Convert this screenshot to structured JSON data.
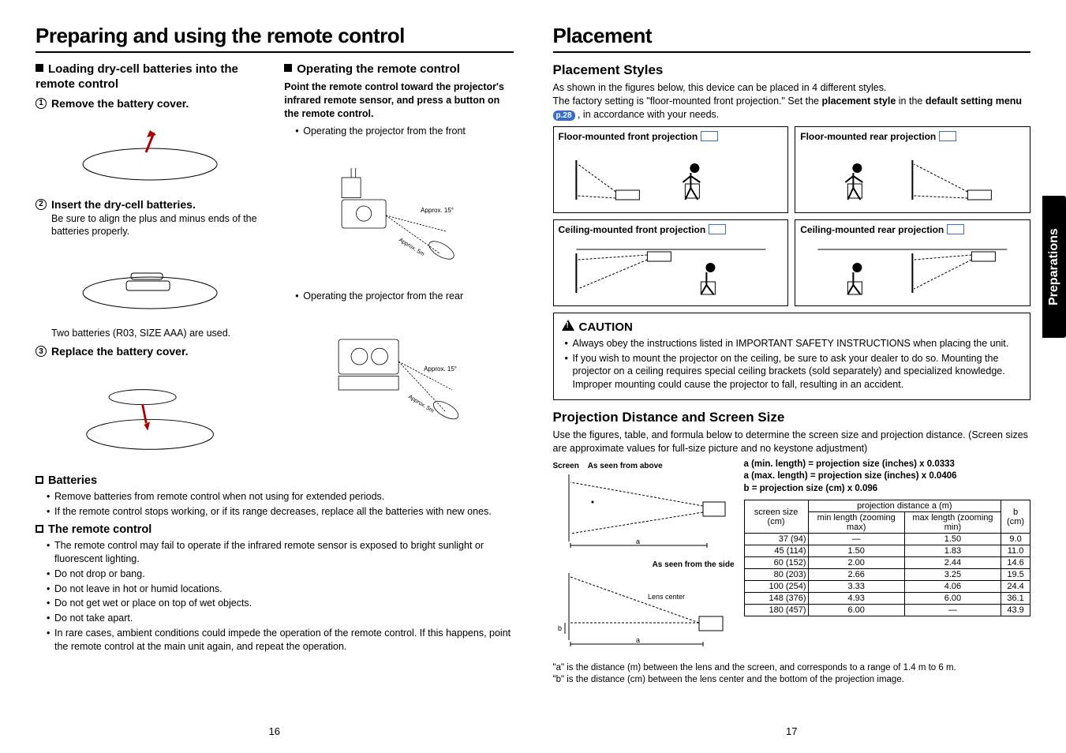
{
  "left": {
    "title": "Preparing and using the remote control",
    "loading_heading": "Loading dry-cell batteries into the remote control",
    "step1": "Remove the battery cover.",
    "step2": "Insert the dry-cell batteries.",
    "step2_note": "Be sure to align the plus and minus ends of the batteries properly.",
    "step2_note2": "Two batteries (R03, SIZE AAA) are used.",
    "step3": "Replace the battery cover.",
    "operating_heading": "Operating the remote control",
    "operating_intro": "Point the remote control toward the projector's infrared remote sensor, and press a button on the remote control.",
    "op_front": "Operating the projector from the front",
    "op_rear": "Operating the projector from the rear",
    "approx_angle": "Approx. 15°",
    "approx_dist": "Approx. 5m",
    "batteries_heading": "Batteries",
    "batteries_bullets": [
      "Remove batteries from remote control when not using for extended periods.",
      "If the remote control stops working, or if its range decreases, replace all the batteries with new ones."
    ],
    "remote_heading": "The remote control",
    "remote_bullets": [
      "The remote control may fail to operate if the infrared remote sensor is exposed to bright sunlight or fluorescent lighting.",
      "Do not drop or bang.",
      "Do not leave in hot or humid locations.",
      "Do not get wet or place on top of wet objects.",
      "Do not take apart.",
      "In rare cases, ambient conditions could impede the operation of the remote control. If this happens, point the remote control at the main unit again, and repeat the operation."
    ],
    "pagenum": "16"
  },
  "right": {
    "title": "Placement",
    "styles_heading": "Placement Styles",
    "styles_p1": "As shown in the figures below, this device can be placed in 4 different styles.",
    "styles_p2a": "The factory setting is \"floor-mounted front projection.\" Set the ",
    "styles_p2b": "placement style",
    "styles_p2c": " in the ",
    "styles_p2d": "default setting menu ",
    "styles_p2e": "p.28",
    "styles_p2f": " , in accordance with your needs.",
    "placements": [
      "Floor-mounted front projection",
      "Floor-mounted rear projection",
      "Ceiling-mounted front projection",
      "Ceiling-mounted rear projection"
    ],
    "caution_title": "CAUTION",
    "caution_bullets": [
      "Always obey the instructions listed in IMPORTANT SAFETY INSTRUCTIONS when placing the unit.",
      "If you wish to mount the projector on the ceiling, be sure to ask your dealer to do so. Mounting the projector on a ceiling requires special ceiling brackets (sold separately) and specialized knowledge. Improper mounting could cause the projector to fall, resulting in an accident."
    ],
    "dist_heading": "Projection Distance and Screen Size",
    "dist_intro": "Use the figures, table, and formula below to determine the screen size and projection distance. (Screen sizes are approximate values for full-size picture and no keystone adjustment)",
    "diag_screen": "Screen",
    "diag_above": "As seen from above",
    "diag_side": "As seen from the side",
    "diag_lens": "Lens center",
    "formulas": [
      "a (min. length) = projection size (inches) x 0.0333",
      "a (max. length) = projection size (inches) x 0.0406",
      "b = projection size (cm) x 0.096"
    ],
    "table": {
      "h_screen": "screen size (cm)",
      "h_proj": "projection distance a (m)",
      "h_min": "min length (zooming max)",
      "h_max": "max length (zooming min)",
      "h_b": "b (cm)",
      "rows": [
        {
          "s": "37",
          "cm": "(94)",
          "min": "—",
          "max": "1.50",
          "b": "9.0"
        },
        {
          "s": "45",
          "cm": "(114)",
          "min": "1.50",
          "max": "1.83",
          "b": "11.0"
        },
        {
          "s": "60",
          "cm": "(152)",
          "min": "2.00",
          "max": "2.44",
          "b": "14.6"
        },
        {
          "s": "80",
          "cm": "(203)",
          "min": "2.66",
          "max": "3.25",
          "b": "19.5"
        },
        {
          "s": "100",
          "cm": "(254)",
          "min": "3.33",
          "max": "4.06",
          "b": "24.4"
        },
        {
          "s": "148",
          "cm": "(376)",
          "min": "4.93",
          "max": "6.00",
          "b": "36.1"
        },
        {
          "s": "180",
          "cm": "(457)",
          "min": "6.00",
          "max": "—",
          "b": "43.9"
        }
      ]
    },
    "foot_a": "\"a\" is the distance (m) between the lens and the screen, and corresponds to a range of 1.4 m to 6 m.",
    "foot_b": "\"b\" is the distance (cm) between the lens center and the bottom of the projection image.",
    "pagenum": "17",
    "side_tab": "Preparations"
  }
}
